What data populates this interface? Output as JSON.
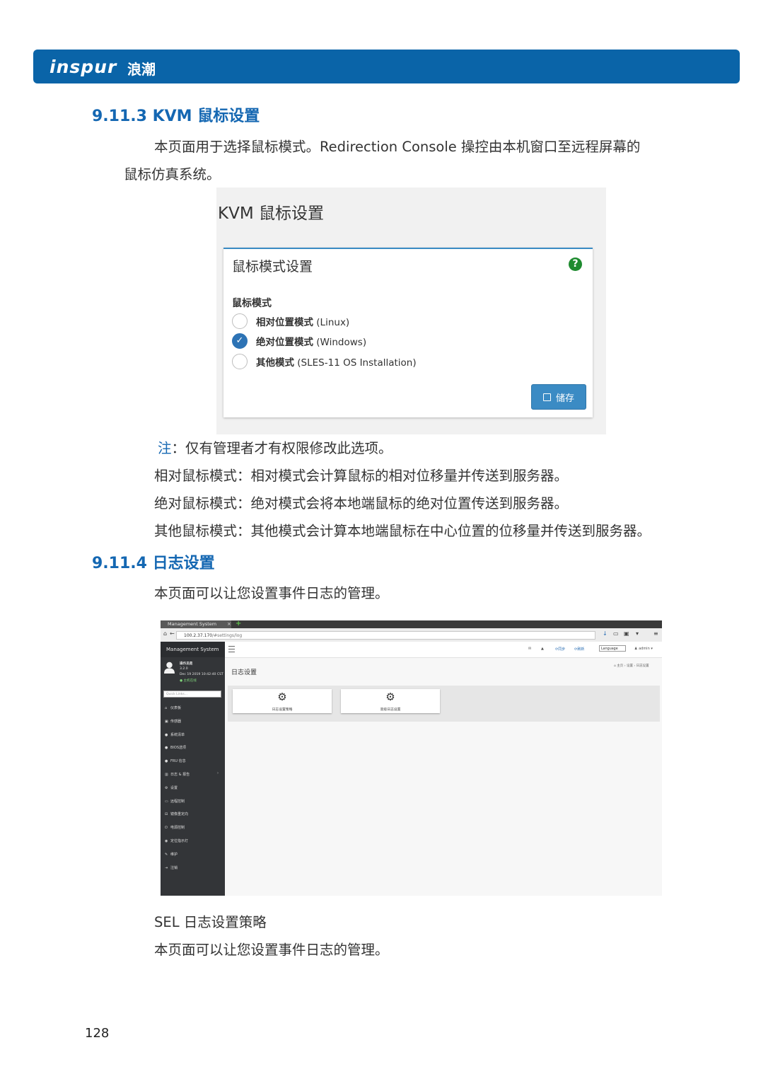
{
  "header": {
    "logo_text": "inspur",
    "logo_cn": "浪潮"
  },
  "section_kvm": {
    "heading": "9.11.3 KVM 鼠标设置",
    "intro_line1": "本页面用于选择鼠标模式。Redirection Console 操控由本机窗口至远程屏幕的",
    "intro_line2": "鼠标仿真系统。"
  },
  "kvm_screenshot": {
    "page_title": "KVM 鼠标设置",
    "card_title": "鼠标模式设置",
    "help_icon": "?",
    "mode_label": "鼠标模式",
    "options": [
      {
        "bold": "相对位置模式",
        "rest": " (Linux)",
        "selected": false
      },
      {
        "bold": "绝对位置模式",
        "rest": " (Windows)",
        "selected": true
      },
      {
        "bold": "其他模式",
        "rest": " (SLES-11 OS Installation)",
        "selected": false
      }
    ],
    "save_label": "储存"
  },
  "notes": {
    "note_label": "注",
    "note_text": "：仅有管理者才有权限修改此选项。",
    "relative": "相对鼠标模式：相对模式会计算鼠标的相对位移量并传送到服务器。",
    "absolute": "绝对鼠标模式：绝对模式会将本地端鼠标的绝对位置传送到服务器。",
    "other": "其他鼠标模式：其他模式会计算本地端鼠标在中心位置的位移量并传送到服务器。"
  },
  "section_log": {
    "heading": "9.11.4 日志设置",
    "intro": "本页面可以让您设置事件日志的管理。"
  },
  "log_screenshot": {
    "tab_title": "Management System",
    "url_host": "100.2.37.170",
    "url_path": "/#settings/log",
    "app_name": "Management System",
    "user_name": "操作员是",
    "version": "3.2.0",
    "datetime": "Dec 19 2019 10:42:40 CST",
    "status": "● 主机在线",
    "quick_links": "Quick Links...",
    "sidebar": [
      {
        "icon": "⌂",
        "label": "仪表板"
      },
      {
        "icon": "▣",
        "label": "传感器"
      },
      {
        "icon": "●",
        "label": "系统清单"
      },
      {
        "icon": "●",
        "label": "BIOS选项"
      },
      {
        "icon": "●",
        "label": "FRU 信息"
      },
      {
        "icon": "▥",
        "label": "日志 & 报告"
      },
      {
        "icon": "⚙",
        "label": "设置"
      },
      {
        "icon": "▭",
        "label": "远程控制"
      },
      {
        "icon": "⊟",
        "label": "镜像重定向"
      },
      {
        "icon": "⏻",
        "label": "电源控制"
      },
      {
        "icon": "◉",
        "label": "定位指示灯"
      },
      {
        "icon": "✎",
        "label": "维护"
      },
      {
        "icon": "⇥",
        "label": "注销"
      }
    ],
    "topbar": {
      "sync": "同步",
      "refresh": "刷新",
      "language": "Language",
      "user": "admin"
    },
    "page_title": "日志设置",
    "breadcrumb": "⌂ 主页 › 设置 › 日志设置",
    "tiles": [
      {
        "icon": "⚙",
        "label": "日志设置策略"
      },
      {
        "icon": "⚙",
        "label": "高级日志设置"
      }
    ]
  },
  "section_sel": {
    "title": "SEL 日志设置策略",
    "text": "本页面可以让您设置事件日志的管理。"
  },
  "page_number": "128"
}
